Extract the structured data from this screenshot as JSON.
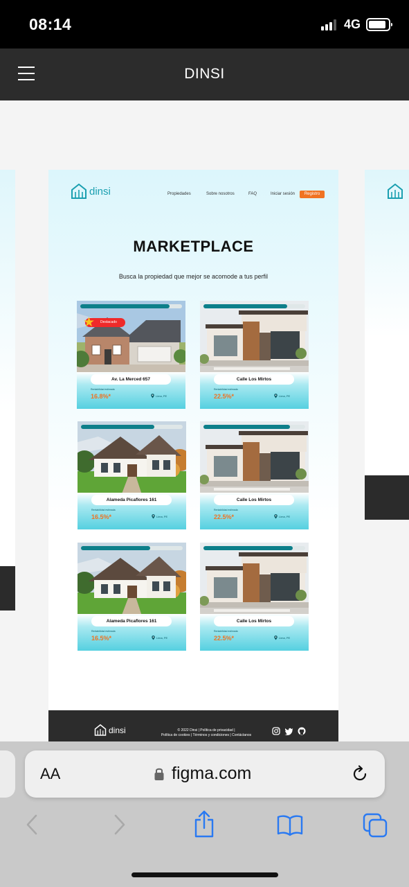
{
  "status_bar": {
    "time": "08:14",
    "network": "4G"
  },
  "app_header": {
    "title": "DINSI",
    "menu_icon": "hamburger-menu-icon"
  },
  "site": {
    "logo_text": "dinsi",
    "nav": [
      "Propiedades",
      "Sobre nosotros",
      "FAQ",
      "Iniciar sesión"
    ],
    "register_label": "Registro",
    "heading": "MARKETPLACE",
    "subheading": "Busca la propiedad que mejor se acomode a tus perfil",
    "featured_label": "Destacado",
    "yield_label": "Rentabilidad estimada",
    "cards": [
      {
        "name": "Av. La Merced 657",
        "rate": "16.8%*",
        "location": "Lima, PE",
        "funded": 0.88,
        "featured": true,
        "image": "house-colonial"
      },
      {
        "name": "Calle Los Mirtos",
        "rate": "22.5%*",
        "location": "Lima, PE",
        "funded": 0.82,
        "featured": false,
        "image": "house-modern"
      },
      {
        "name": "Alameda Picaflores 161",
        "rate": "16.5%*",
        "location": "Lima, PE",
        "funded": 0.72,
        "featured": false,
        "image": "house-alpine"
      },
      {
        "name": "Calle Los Mirtos",
        "rate": "22.5%*",
        "location": "Lima, PE",
        "funded": 0.85,
        "featured": false,
        "image": "house-modern"
      },
      {
        "name": "Alameda Picaflores 161",
        "rate": "16.5%*",
        "location": "Lima, PE",
        "funded": 0.68,
        "featured": false,
        "image": "house-alpine"
      },
      {
        "name": "Calle Los Mirtos",
        "rate": "22.5%*",
        "location": "Lima, PE",
        "funded": 0.88,
        "featured": false,
        "image": "house-modern"
      }
    ],
    "footer": {
      "logo_text": "dinsi",
      "line1": "© 2022 Dinsi | Política de privacidad |",
      "line2": "Política de cookies | Términos y condiciones | Contáctanos",
      "social_icons": [
        "instagram-icon",
        "twitter-icon",
        "github-icon"
      ]
    }
  },
  "browser": {
    "aa_label": "AA",
    "url": "figma.com",
    "toolbar": [
      "back-icon",
      "forward-icon",
      "share-icon",
      "bookmarks-icon",
      "tabs-icon"
    ]
  },
  "colors": {
    "accent": "#f07322",
    "brand": "#1a9fb0",
    "dark": "#2c2c2c",
    "featured": "#ef2a2a"
  }
}
